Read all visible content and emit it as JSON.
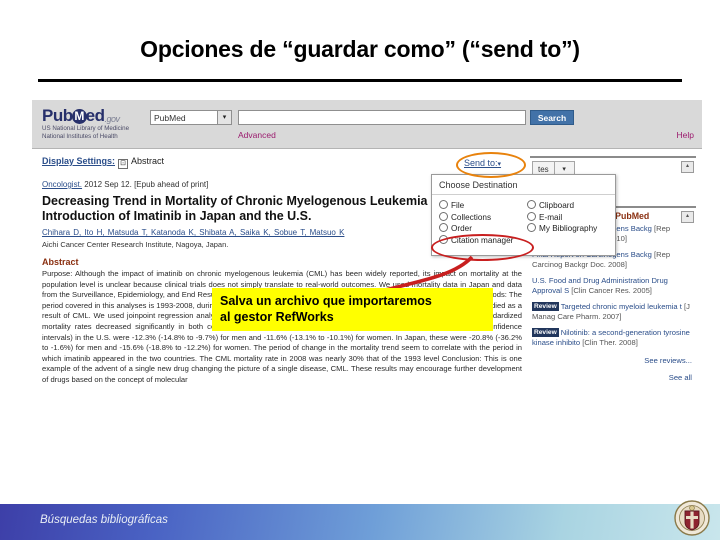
{
  "slide": {
    "title": "Opciones de “guardar como” (“send to”)"
  },
  "pubmed": {
    "logo": {
      "pre": "Pub",
      "mid": "M",
      "post": "ed",
      "suffix": ".gov"
    },
    "tagline_line1": "US National Library of Medicine",
    "tagline_line2": "National Institutes of Health",
    "database_value": "PubMed",
    "search_value": "",
    "search_placeholder": "",
    "search_button": "Search",
    "advanced_link": "Advanced",
    "help_link": "Help",
    "display_settings_label": "Display Settings:",
    "display_settings_value": "Abstract",
    "checkbox_glyph": "⊡",
    "journal_link": "Oncologist.",
    "journal_rest": " 2012 Sep 12. [Epub ahead of print]",
    "article_title": "Decreasing Trend in Mortality of Chronic Myelogenous Leukemia Patients After Introduction of Imatinib in Japan and the U.S.",
    "authors": "Chihara D, Ito H, Matsuda T, Katanoda K, Shibata A, Saika K, Sobue T, Matsuo K",
    "affiliation": "Aichi Cancer Center Research Institute, Nagoya, Japan.",
    "abstract_heading": "Abstract",
    "abstract_body": "Purpose: Although the impact of imatinib on chronic myelogenous leukemia (CML) has been widely reported, its impact on mortality at the population level is unclear because clinical trials does not simply translate to real-world outcomes. We used mortality data in Japan and data from the Surveillance, Epidemiology, and End Results (SEER) Program of the National Cancer Institute for the U.S. Patients and Methods: The period covered in this analyses is 1993-2008, during which 54,203 patients in Japan and 20,000 patients in nine registries in the U.S. died as a result of CML. We used joinpoint regression analysis to evaluate the significance of trends in mortality Results: Estimated age-standardized mortality rates decreased significantly in both countries after the availability of imatinib. The annual percent changes (95% confidence intervals) in the U.S. were -12.3% (-14.8% to -9.7%) for men and -11.6% (-13.1% to -10.1%) for women. In Japan, these were -20.8% (-36.2% to -1.6%) for men and -15.6% (-18.8% to -12.2%) for women. The period of change in the mortality trend seem to correlate with the period in which imatinib appeared in the two countries. The CML mortality rate in 2008 was nearly 30% that of the 1993 level Conclusion: This is one example of the advent of a single new drug changing the picture of a single disease, CML. These results may encourage further development of drugs based on the concept of molecular"
  },
  "send_to": {
    "link_label": "Send to:",
    "caret": "▾",
    "panel_heading": "Choose Destination",
    "options_left": [
      "File",
      "Collections",
      "Order",
      "Citation manager"
    ],
    "options_right": [
      "Clipboard",
      "E-mail",
      "My Bibliography"
    ],
    "highlight_color_link": "#e8820c",
    "highlight_color_option": "#c81f1f"
  },
  "sidebar": {
    "filter_box_label": "tes",
    "filter_arrow": "▾",
    "related_heading": "Related citations in PubMed",
    "collapse_glyph": "▴",
    "items": [
      {
        "badge": "",
        "title": "Final Report on Carcinogens Backg",
        "journal": "[Rep Carcinog Backgr Doc. 2010]"
      },
      {
        "badge": "",
        "title": "Final Report on Carcinogens Backg",
        "journal": "[Rep Carcinog Backgr Doc. 2008]"
      },
      {
        "badge": "",
        "title": "U.S. Food and Drug Administration Drug Approval S",
        "journal": "[Clin Cancer Res. 2005]"
      },
      {
        "badge": "Review",
        "title": "Targeted chronic myeloid leukemia t",
        "journal": "[J Manag Care Pharm. 2007]"
      },
      {
        "badge": "Review",
        "title": "Nilotinib: a second-generation tyrosine kinase inhibito",
        "journal": "[Clin Ther. 2008]"
      }
    ],
    "see_reviews": "See reviews...",
    "see_all": "See all"
  },
  "callout": {
    "line1": "Salva un archivo que importaremos",
    "line2": "al gestor RefWorks",
    "background": "#ffff00",
    "arrow_color": "#c81f1f"
  },
  "footer": {
    "text": "Búsquedas bibliográficas"
  }
}
